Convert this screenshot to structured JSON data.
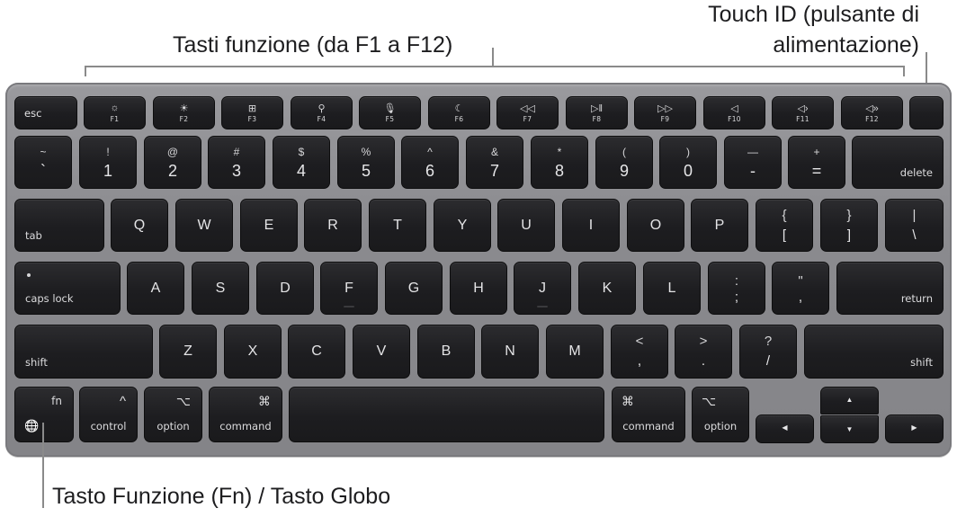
{
  "callouts": {
    "function_keys": "Tasti funzione (da F1 a F12)",
    "touch_id_line1": "Touch ID (pulsante di",
    "touch_id_line2": "alimentazione)",
    "fn_globe": "Tasto Funzione (Fn) / Tasto Globo"
  },
  "keyboard": {
    "function_row": [
      {
        "label": "esc"
      },
      {
        "icon": "brightness-down-icon",
        "glyph": "☼",
        "label": "F1"
      },
      {
        "icon": "brightness-up-icon",
        "glyph": "☀",
        "label": "F2"
      },
      {
        "icon": "mission-control-icon",
        "glyph": "⊞",
        "label": "F3"
      },
      {
        "icon": "search-icon",
        "glyph": "⚲",
        "label": "F4"
      },
      {
        "icon": "microphone-icon",
        "glyph": "🎙",
        "label": "F5"
      },
      {
        "icon": "moon-icon",
        "glyph": "☾",
        "label": "F6"
      },
      {
        "icon": "rewind-icon",
        "glyph": "◁◁",
        "label": "F7"
      },
      {
        "icon": "play-pause-icon",
        "glyph": "▷‖",
        "label": "F8"
      },
      {
        "icon": "fast-forward-icon",
        "glyph": "▷▷",
        "label": "F9"
      },
      {
        "icon": "mute-icon",
        "glyph": "◁",
        "label": "F10"
      },
      {
        "icon": "volume-down-icon",
        "glyph": "◁›",
        "label": "F11"
      },
      {
        "icon": "volume-up-icon",
        "glyph": "◁»",
        "label": "F12"
      },
      {
        "label": "",
        "name": "touch-id"
      }
    ],
    "number_row": [
      {
        "shift": "~",
        "main": "`"
      },
      {
        "shift": "!",
        "main": "1"
      },
      {
        "shift": "@",
        "main": "2"
      },
      {
        "shift": "#",
        "main": "3"
      },
      {
        "shift": "$",
        "main": "4"
      },
      {
        "shift": "%",
        "main": "5"
      },
      {
        "shift": "^",
        "main": "6"
      },
      {
        "shift": "&",
        "main": "7"
      },
      {
        "shift": "*",
        "main": "8"
      },
      {
        "shift": "(",
        "main": "9"
      },
      {
        "shift": ")",
        "main": "0"
      },
      {
        "shift": "—",
        "main": "-"
      },
      {
        "shift": "+",
        "main": "="
      },
      {
        "label": "delete"
      }
    ],
    "top_row": {
      "tab": "tab",
      "letters": [
        "Q",
        "W",
        "E",
        "R",
        "T",
        "Y",
        "U",
        "I",
        "O",
        "P"
      ],
      "brackets": [
        {
          "shift": "{",
          "main": "["
        },
        {
          "shift": "}",
          "main": "]"
        },
        {
          "shift": "|",
          "main": "\\"
        }
      ]
    },
    "home_row": {
      "caps": "caps lock",
      "letters": [
        "A",
        "S",
        "D",
        "F",
        "G",
        "H",
        "J",
        "K",
        "L"
      ],
      "punct": [
        {
          "shift": ":",
          "main": ";"
        },
        {
          "shift": "\"",
          "main": ","
        }
      ],
      "return": "return"
    },
    "bottom_row": {
      "left_shift": "shift",
      "letters": [
        "Z",
        "X",
        "C",
        "V",
        "B",
        "N",
        "M"
      ],
      "punct": [
        {
          "shift": "<",
          "main": ","
        },
        {
          "shift": ">",
          "main": "."
        },
        {
          "shift": "?",
          "main": "/"
        }
      ],
      "right_shift": "shift"
    },
    "modifier_row": {
      "fn": {
        "label": "fn",
        "icon": "globe-icon",
        "glyph": "🌐"
      },
      "control": {
        "label": "control",
        "glyph": "^"
      },
      "option_left": {
        "label": "option",
        "glyph": "⌥"
      },
      "command_left": {
        "label": "command",
        "glyph": "⌘"
      },
      "command_right": {
        "label": "command",
        "glyph": "⌘"
      },
      "option_right": {
        "label": "option",
        "glyph": "⌥"
      },
      "arrows": {
        "left": "◀",
        "up": "▲",
        "down": "▼",
        "right": "▶"
      }
    }
  }
}
